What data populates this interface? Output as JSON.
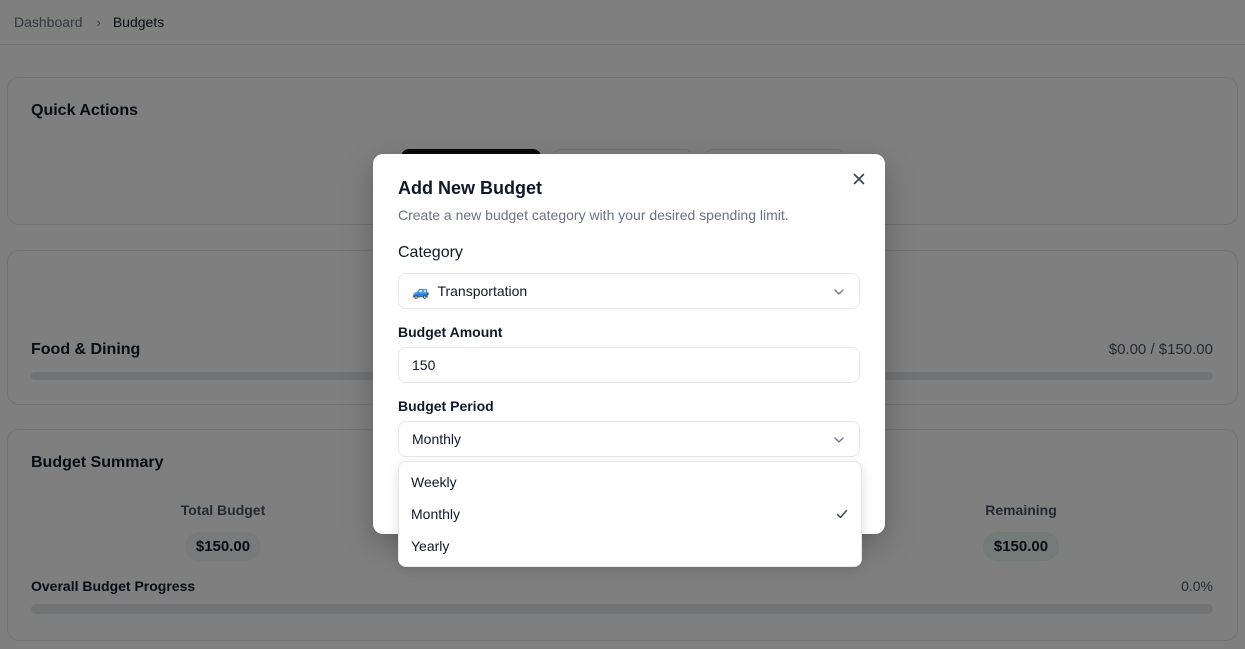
{
  "breadcrumb": {
    "parent": "Dashboard",
    "separator": "›",
    "current": "Budgets"
  },
  "quick_actions": {
    "title": "Quick Actions"
  },
  "budgets": [
    {
      "name": "Food & Dining",
      "amount": "$0.00 / $150.00",
      "progress": 0
    }
  ],
  "summary": {
    "title": "Budget Summary",
    "total_label": "Total Budget",
    "total_value": "$150.00",
    "remaining_label": "Remaining",
    "remaining_value": "$150.00",
    "progress_label": "Overall Budget Progress",
    "progress_value": "0.0%",
    "progress": 0
  },
  "modal": {
    "title": "Add New Budget",
    "description": "Create a new budget category with your desired spending limit.",
    "category_label": "Category",
    "category_value": "Transportation",
    "category_icon": "🚙",
    "amount_label": "Budget Amount",
    "amount_value": "150",
    "period_label": "Budget Period",
    "period_value": "Monthly",
    "period_options": [
      "Weekly",
      "Monthly",
      "Yearly"
    ],
    "selected_option": "Monthly"
  },
  "icons": {
    "close": "close-icon",
    "chevron": "chevron-down-icon",
    "check": "check-icon"
  },
  "colors": {
    "overlay": "rgba(0,0,0,0.5)",
    "primary": "#111111",
    "remaining_pill": "#e6f4ef"
  }
}
